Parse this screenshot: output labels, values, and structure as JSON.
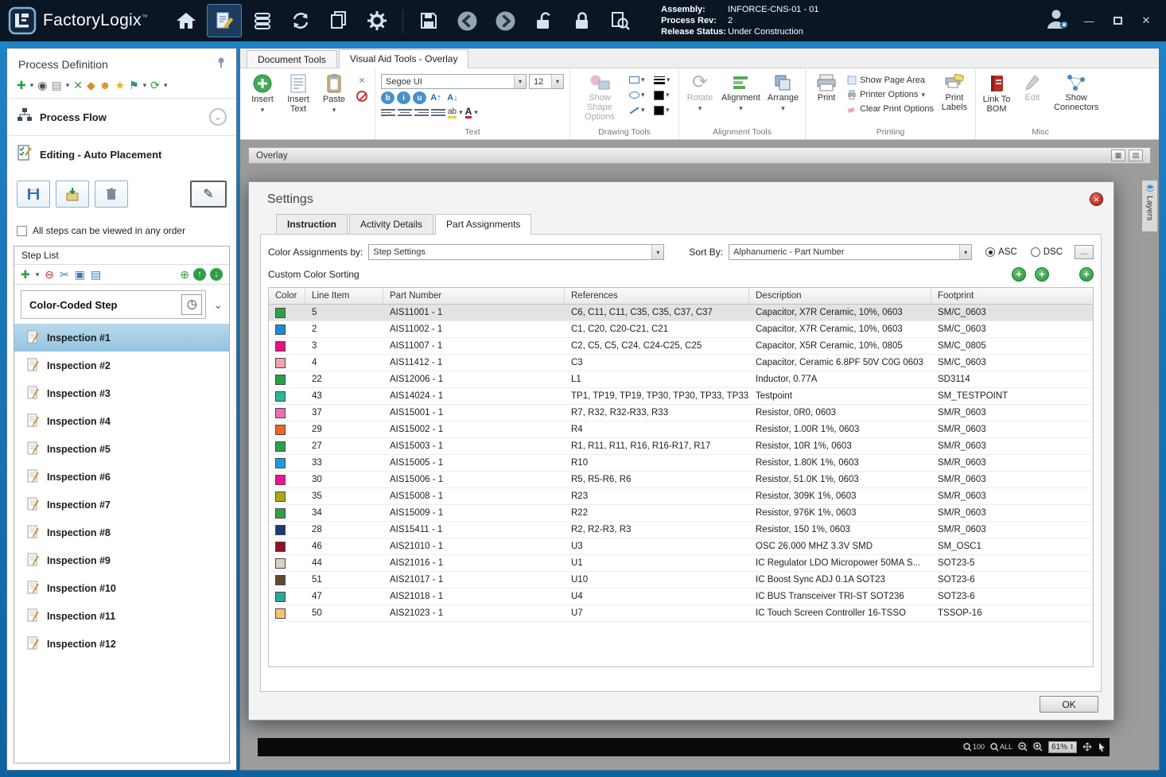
{
  "titlebar": {
    "app_name": "FactoryLogix",
    "trademark": "™",
    "assembly_label": "Assembly:",
    "assembly_value": "INFORCE-CNS-01 - 01",
    "process_rev_label": "Process Rev:",
    "process_rev_value": "2",
    "release_status_label": "Release Status:",
    "release_status_value": "Under Construction"
  },
  "sidebar": {
    "title": "Process Definition",
    "process_flow_label": "Process Flow",
    "editing_label": "Editing - Auto Placement",
    "any_order_checkbox_label": "All steps can be viewed in any order",
    "any_order_checked": false,
    "step_list_title": "Step List",
    "color_coded_label": "Color-Coded Step",
    "selected_index": 0,
    "steps": [
      "Inspection #1",
      "Inspection #2",
      "Inspection #3",
      "Inspection #4",
      "Inspection #5",
      "Inspection #6",
      "Inspection #7",
      "Inspection #8",
      "Inspection #9",
      "Inspection #10",
      "Inspection #11",
      "Inspection #12"
    ]
  },
  "ribbon": {
    "tabs": [
      "Document Tools",
      "Visual Aid Tools - Overlay"
    ],
    "insert": "Insert",
    "insert_text": "Insert\nText",
    "paste": "Paste",
    "font_family": "Segoe UI",
    "font_size": "12",
    "group_text": "Text",
    "show_shape_options": "Show Shape\nOptions",
    "group_drawing": "Drawing Tools",
    "rotate": "Rotate",
    "alignment": "Alignment",
    "arrange": "Arrange",
    "group_alignment": "Alignment Tools",
    "print": "Print",
    "show_page_area": "Show Page Area",
    "printer_options": "Printer Options",
    "clear_print_options": "Clear Print Options",
    "print_labels": "Print\nLabels",
    "group_printing": "Printing",
    "link_to_bom": "Link To\nBOM",
    "edit": "Edit",
    "show_connectors": "Show\nConnectors",
    "group_misc": "Misc"
  },
  "overlay_bar": {
    "label": "Overlay"
  },
  "layers_tab": {
    "label": "Layers"
  },
  "statusbar": {
    "zoom_100": "100",
    "zoom_all": "ALL",
    "zoom_level": "61%"
  },
  "dialog": {
    "title": "Settings",
    "tabs": [
      "Instruction",
      "Activity Details",
      "Part Assignments"
    ],
    "active_tab": "Part Assignments",
    "color_assignments_label": "Color Assignments by:",
    "color_assignments_value": "Step Settings",
    "sort_by_label": "Sort By:",
    "sort_by_value": "Alphanumeric - Part Number",
    "asc_label": "ASC",
    "dsc_label": "DSC",
    "sort_direction": "ASC",
    "more_button_label": "...",
    "custom_color_sorting_label": "Custom Color Sorting",
    "ok_label": "OK",
    "table": {
      "columns": [
        "Color",
        "Line Item",
        "Part Number",
        "References",
        "Description",
        "Footprint"
      ],
      "rows": [
        {
          "color": "#2da04a",
          "line_item": "5",
          "part_number": "AIS11001 - 1",
          "references": "C6, C11, C11, C35, C35, C37, C37",
          "description": "Capacitor, X7R Ceramic, 10%, 0603",
          "footprint": "SM/C_0603",
          "selected": true
        },
        {
          "color": "#1e8bd8",
          "line_item": "2",
          "part_number": "AIS11002 - 1",
          "references": "C1, C20, C20-C21, C21",
          "description": "Capacitor, X7R Ceramic, 10%, 0603",
          "footprint": "SM/C_0603"
        },
        {
          "color": "#e5127e",
          "line_item": "3",
          "part_number": "AIS11007 - 1",
          "references": "C2, C5, C5, C24, C24-C25, C25",
          "description": "Capacitor, X5R Ceramic, 10%, 0805",
          "footprint": "SM/C_0805"
        },
        {
          "color": "#f2a3ac",
          "line_item": "4",
          "part_number": "AIS11412 - 1",
          "references": "C3",
          "description": "Capacitor, Ceramic 6.8PF 50V C0G 0603",
          "footprint": "SM/C_0603"
        },
        {
          "color": "#29a147",
          "line_item": "22",
          "part_number": "AIS12006 - 1",
          "references": "L1",
          "description": "Inductor, 0.77A",
          "footprint": "SD3114"
        },
        {
          "color": "#2ab795",
          "line_item": "43",
          "part_number": "AIS14024 - 1",
          "references": "TP1, TP19, TP19, TP30, TP30, TP33, TP33",
          "description": "Testpoint",
          "footprint": "SM_TESTPOINT"
        },
        {
          "color": "#ee6eb6",
          "line_item": "37",
          "part_number": "AIS15001 - 1",
          "references": "R7, R32, R32-R33, R33",
          "description": "Resistor, 0R0, 0603",
          "footprint": "SM/R_0603"
        },
        {
          "color": "#f0641e",
          "line_item": "29",
          "part_number": "AIS15002 - 1",
          "references": "R4",
          "description": "Resistor, 1.00R 1%, 0603",
          "footprint": "SM/R_0603"
        },
        {
          "color": "#2da04a",
          "line_item": "27",
          "part_number": "AIS15003 - 1",
          "references": "R1, R11, R11, R16, R16-R17, R17",
          "description": "Resistor, 10R 1%, 0603",
          "footprint": "SM/R_0603"
        },
        {
          "color": "#1e9ae4",
          "line_item": "33",
          "part_number": "AIS15005 - 1",
          "references": "R10",
          "description": "Resistor, 1.80K 1%, 0603",
          "footprint": "SM/R_0603"
        },
        {
          "color": "#ed1390",
          "line_item": "30",
          "part_number": "AIS15006 - 1",
          "references": "R5, R5-R6, R6",
          "description": "Resistor, 51.0K 1%, 0603",
          "footprint": "SM/R_0603"
        },
        {
          "color": "#a8aa16",
          "line_item": "35",
          "part_number": "AIS15008 - 1",
          "references": "R23",
          "description": "Resistor, 309K 1%, 0603",
          "footprint": "SM/R_0603"
        },
        {
          "color": "#2da04a",
          "line_item": "34",
          "part_number": "AIS15009 - 1",
          "references": "R22",
          "description": "Resistor, 976K 1%, 0603",
          "footprint": "SM/R_0603"
        },
        {
          "color": "#1b3a74",
          "line_item": "28",
          "part_number": "AIS15411 - 1",
          "references": "R2, R2-R3, R3",
          "description": "Resistor, 150 1%, 0603",
          "footprint": "SM/R_0603"
        },
        {
          "color": "#901226",
          "line_item": "46",
          "part_number": "AIS21010 - 1",
          "references": "U3",
          "description": "OSC 26.000 MHZ 3.3V SMD",
          "footprint": "SM_OSC1"
        },
        {
          "color": "#d9d2c6",
          "line_item": "44",
          "part_number": "AIS21016 - 1",
          "references": "U1",
          "description": "IC Regulator LDO Micropower 50MA S...",
          "footprint": "SOT23-5"
        },
        {
          "color": "#5c4a34",
          "line_item": "51",
          "part_number": "AIS21017 - 1",
          "references": "U10",
          "description": "IC Boost Sync ADJ 0.1A SOT23",
          "footprint": "SOT23-6"
        },
        {
          "color": "#28a79c",
          "line_item": "47",
          "part_number": "AIS21018 - 1",
          "references": "U4",
          "description": "IC BUS Transceiver TRI-ST SOT236",
          "footprint": "SOT23-6"
        },
        {
          "color": "#f6c474",
          "line_item": "50",
          "part_number": "AIS21023 - 1",
          "references": "U7",
          "description": "IC Touch Screen Controller 16-TSSO",
          "footprint": "TSSOP-16"
        }
      ]
    }
  }
}
